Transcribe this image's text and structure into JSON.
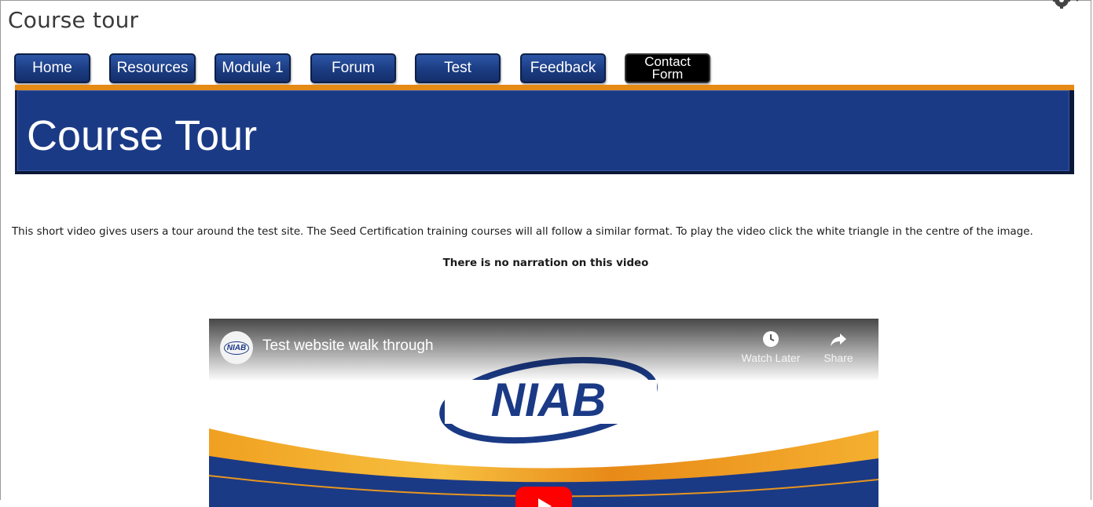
{
  "page": {
    "title": "Course tour"
  },
  "nav": {
    "items": [
      {
        "label": "Home",
        "name": "nav-home-button"
      },
      {
        "label": "Resources",
        "name": "nav-resources-button"
      },
      {
        "label": "Module 1",
        "name": "nav-module-1-button"
      },
      {
        "label": "Forum",
        "name": "nav-forum-button"
      },
      {
        "label": "Test",
        "name": "nav-test-button"
      },
      {
        "label": "Feedback",
        "name": "nav-feedback-button"
      },
      {
        "label": "Contact\nForm",
        "name": "nav-contact-form-button"
      }
    ]
  },
  "banner": {
    "title": "Course Tour"
  },
  "content": {
    "intro": "This short video gives users a tour around the test site. The Seed Certification training courses will all follow a similar format. To play the video click the white triangle in the centre of the image.",
    "note": "There is no narration on this video"
  },
  "video": {
    "channel_logo": "NIAB",
    "title": "Test website walk through",
    "brand": "NIAB",
    "watch_later": "Watch Later",
    "share": "Share"
  },
  "colors": {
    "nav_blue": "#1b3c82",
    "banner_blue": "#1b3a86",
    "accent_orange": "#e48a15",
    "play_red": "#ff0000"
  },
  "icons": {
    "settings": "gear-icon",
    "watch_later": "clock-icon",
    "share": "share-arrow-icon",
    "play": "play-icon"
  }
}
